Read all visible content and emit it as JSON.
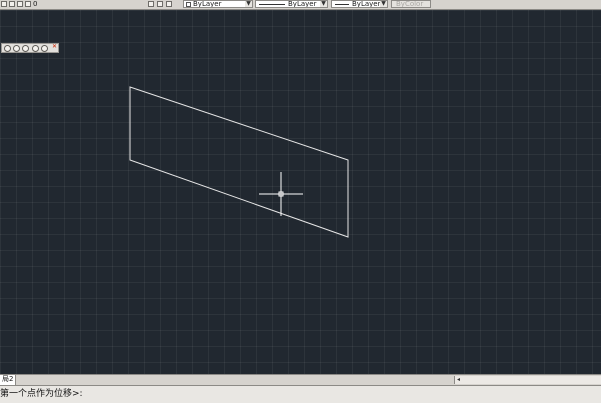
{
  "toolbar": {
    "layer_name": "0",
    "color_value": "ByLayer",
    "linetype_value": "ByLayer",
    "lineweight_value": "ByLayer",
    "plotstyle_value": "ByColor"
  },
  "layout_tabs": [
    {
      "label": "局2"
    }
  ],
  "command_line": {
    "prompt": "第一个点作为位移>:"
  },
  "icons": {
    "layer_state": "lightbulb-sun-lock-icon",
    "view_tools": [
      "zoom-icon",
      "pan-icon",
      "orbit-icon",
      "navigate-icon",
      "wheel-icon"
    ],
    "close": "close-icon",
    "crosshair": "crosshair-cursor-icon"
  },
  "colors": {
    "canvas_background": "#212830",
    "geometry_stroke": "#e6e6e6",
    "cursor_stroke": "#ffffff",
    "toolbar_background": "#d6d3ce"
  }
}
